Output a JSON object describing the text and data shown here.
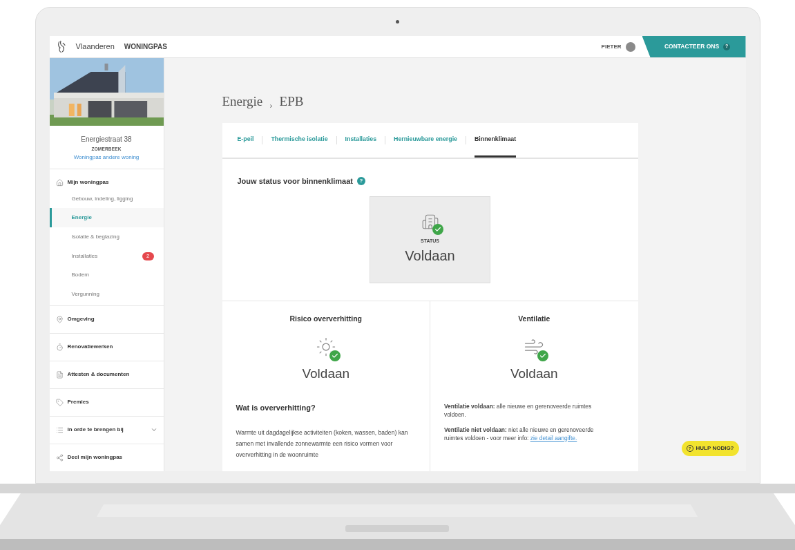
{
  "header": {
    "brand": "Vlaanderen",
    "app": "WONINGPAS",
    "user": "PIETER",
    "contact": "CONTACTEER ONS",
    "contact_help": "?"
  },
  "property": {
    "kind": "picture",
    "address": "Energiestraat 38",
    "city": "ZOMERBEEK",
    "link": "Woningpas andere woning"
  },
  "sidebar": {
    "items": [
      {
        "label": "Mijn woningpas",
        "kind": "home",
        "children": [
          {
            "label": "Gebouw, indeling, ligging",
            "selected": false
          },
          {
            "label": "Energie",
            "selected": true
          },
          {
            "label": "Isolatie & beglazing",
            "selected": false
          },
          {
            "label": "Installaties",
            "selected": false,
            "badge": "2"
          },
          {
            "label": "Bodem",
            "selected": false
          },
          {
            "label": "Vergunning",
            "selected": false
          }
        ]
      },
      {
        "label": "Omgeving",
        "kind": "location"
      },
      {
        "label": "Renovatiewerken",
        "kind": "timer"
      },
      {
        "label": "Attesten & documenten",
        "kind": "document"
      },
      {
        "label": "Premies",
        "kind": "tag"
      },
      {
        "label": "In orde te brengen bij",
        "kind": "list",
        "expanded": false
      },
      {
        "label": "Deel mijn woningpas",
        "kind": "share"
      }
    ]
  },
  "breadcrumb": {
    "items": [
      "Energie",
      "EPB"
    ],
    "separator": "›"
  },
  "tabs": [
    {
      "label": "E-peil",
      "selected": false
    },
    {
      "label": "Thermische isolatie",
      "selected": false
    },
    {
      "label": "Installaties",
      "selected": false
    },
    {
      "label": "Hernieuwbare energie",
      "selected": false
    },
    {
      "label": "Binnenklimaat",
      "selected": true
    }
  ],
  "status": {
    "heading": "Jouw status voor binnenklimaat",
    "help": "?",
    "label": "STATUS",
    "value": "Voldaan",
    "ok": true
  },
  "panels": [
    {
      "kind": "sun",
      "title": "Risico oververhitting",
      "value": "Voldaan",
      "ok": true,
      "subheading": "Wat is oververhitting?",
      "paragraphs": [
        "Warmte uit dagdagelijkse activiteiten (koken, wassen, baden) kan samen met invallende zonnewarmte een risico vormen voor oververhitting in de woonruimte"
      ]
    },
    {
      "kind": "wind",
      "title": "Ventilatie",
      "value": "Voldaan",
      "ok": true,
      "paragraphs": [
        "**Ventilatie voldaan:**  alle nieuwe en gerenoveerde ruimtes voldoen.",
        "**Ventilatie niet voldaan:** niet alle nieuwe en gerenoveerde ruimtes voldoen -  voor meer info:"
      ],
      "link": "zie detail aangifte."
    }
  ],
  "help_button": {
    "label": "HULP NODIG?",
    "icon": "?"
  }
}
